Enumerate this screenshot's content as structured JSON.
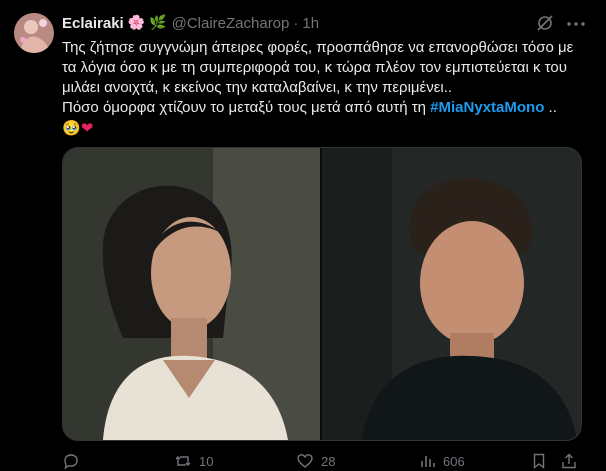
{
  "author": {
    "display_name": "Eclairaki",
    "name_emojis": [
      "🌸",
      "🌿"
    ],
    "handle": "@ClaireZacharop",
    "separator": "·",
    "time": "1h"
  },
  "tweet": {
    "line1": "Της ζήτησε συγγνώμη άπειρες φορές, προσπάθησε να επανορθώσει τόσο με τα λόγια όσο κ με τη συμπεριφορά του, κ τώρα πλέον τον εμπιστεύεται κ του μιλάει ανοιχτά, κ εκείνος την καταλαβαίνει, κ την περιμένει..",
    "line2_prefix": "Πόσο όμορφα χτίζουν το μεταξύ τους μετά από αυτή τη ",
    "hashtag": "#MiaNyxtaMono",
    "line2_suffix": " ..",
    "reaction_emojis": [
      "🥹",
      "❤"
    ]
  },
  "media": {
    "left_panel": "scene-woman",
    "right_panel": "scene-man"
  },
  "actions": {
    "reply": "",
    "retweet": "10",
    "like": "28",
    "views": "606"
  },
  "icons": {
    "grok": "grok-icon",
    "more": "more-icon",
    "reply": "reply-icon",
    "retweet": "retweet-icon",
    "like": "heart-icon",
    "views": "views-icon",
    "bookmark": "bookmark-icon",
    "share": "share-icon"
  },
  "colors": {
    "background": "#000000",
    "text": "#e7e9ea",
    "muted": "#71767b",
    "accent": "#1d9bf0"
  }
}
